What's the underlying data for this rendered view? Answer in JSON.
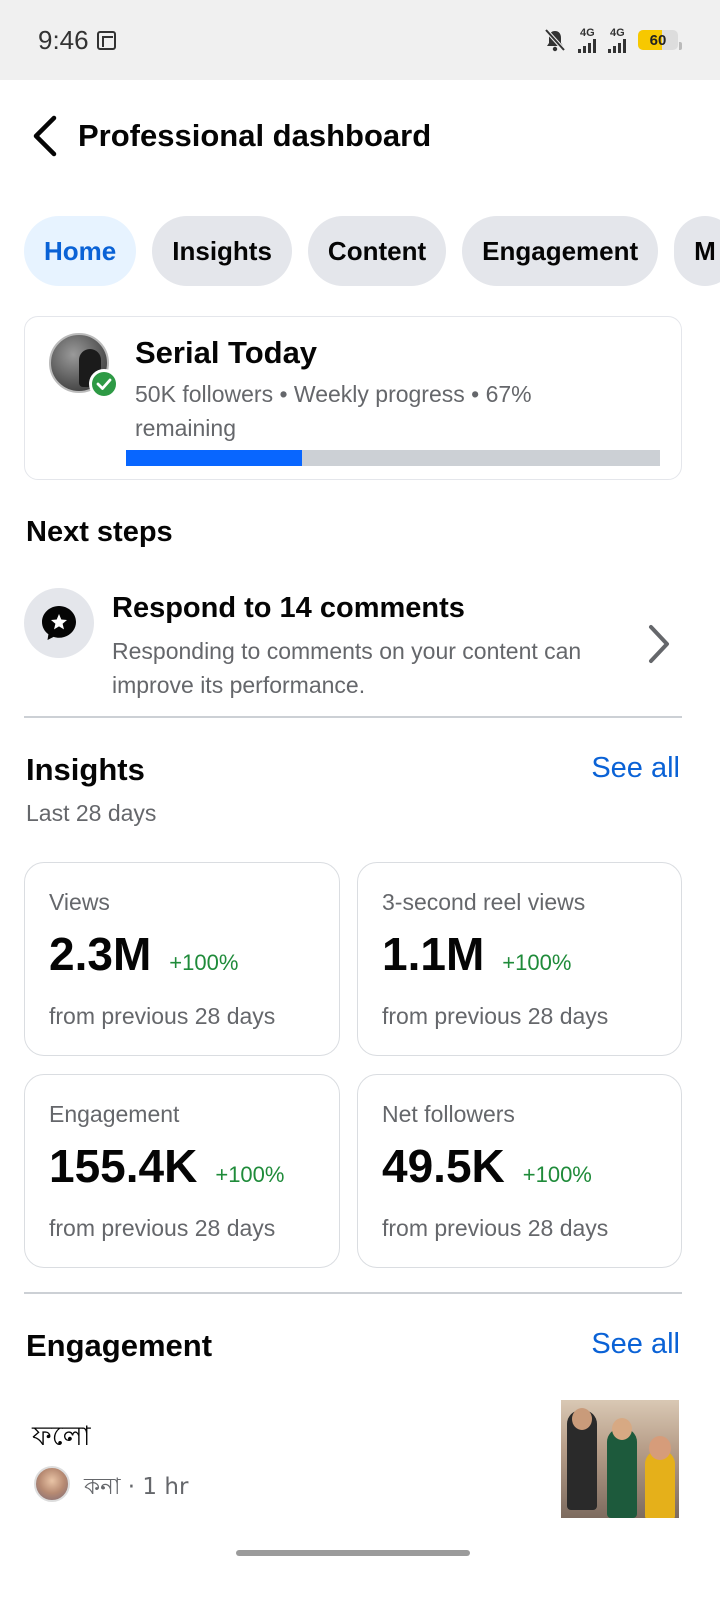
{
  "status_bar": {
    "time": "9:46",
    "network_1": "4G",
    "network_2": "4G",
    "battery_level": "60",
    "battery_percent": 60
  },
  "header": {
    "title": "Professional dashboard"
  },
  "tabs": [
    {
      "label": "Home",
      "active": true
    },
    {
      "label": "Insights",
      "active": false
    },
    {
      "label": "Content",
      "active": false
    },
    {
      "label": "Engagement",
      "active": false
    },
    {
      "label": "M",
      "active": false
    }
  ],
  "profile": {
    "name": "Serial Today",
    "meta": "50K followers • Weekly progress • 67% remaining",
    "progress_percent": 33
  },
  "next_steps": {
    "title": "Next steps",
    "item": {
      "title": "Respond to 14 comments",
      "description": "Responding to comments on your content can improve its performance."
    }
  },
  "insights": {
    "title": "Insights",
    "see_all": "See all",
    "period": "Last 28 days",
    "cards": [
      {
        "label": "Views",
        "value": "2.3M",
        "change": "+100%",
        "sub": "from previous 28 days"
      },
      {
        "label": "3-second reel views",
        "value": "1.1M",
        "change": "+100%",
        "sub": "from previous 28 days"
      },
      {
        "label": "Engagement",
        "value": "155.4K",
        "change": "+100%",
        "sub": "from previous 28 days"
      },
      {
        "label": "Net followers",
        "value": "49.5K",
        "change": "+100%",
        "sub": "from previous 28 days"
      }
    ]
  },
  "engagement": {
    "title": "Engagement",
    "see_all": "See all",
    "item": {
      "title": "ফলো",
      "meta": "কনা · 1 hr"
    }
  },
  "colors": {
    "accent": "#0a62d6",
    "progress": "#0866ff",
    "positive": "#1f8b3a",
    "verified": "#2e9a45",
    "battery": "#f7c800"
  }
}
